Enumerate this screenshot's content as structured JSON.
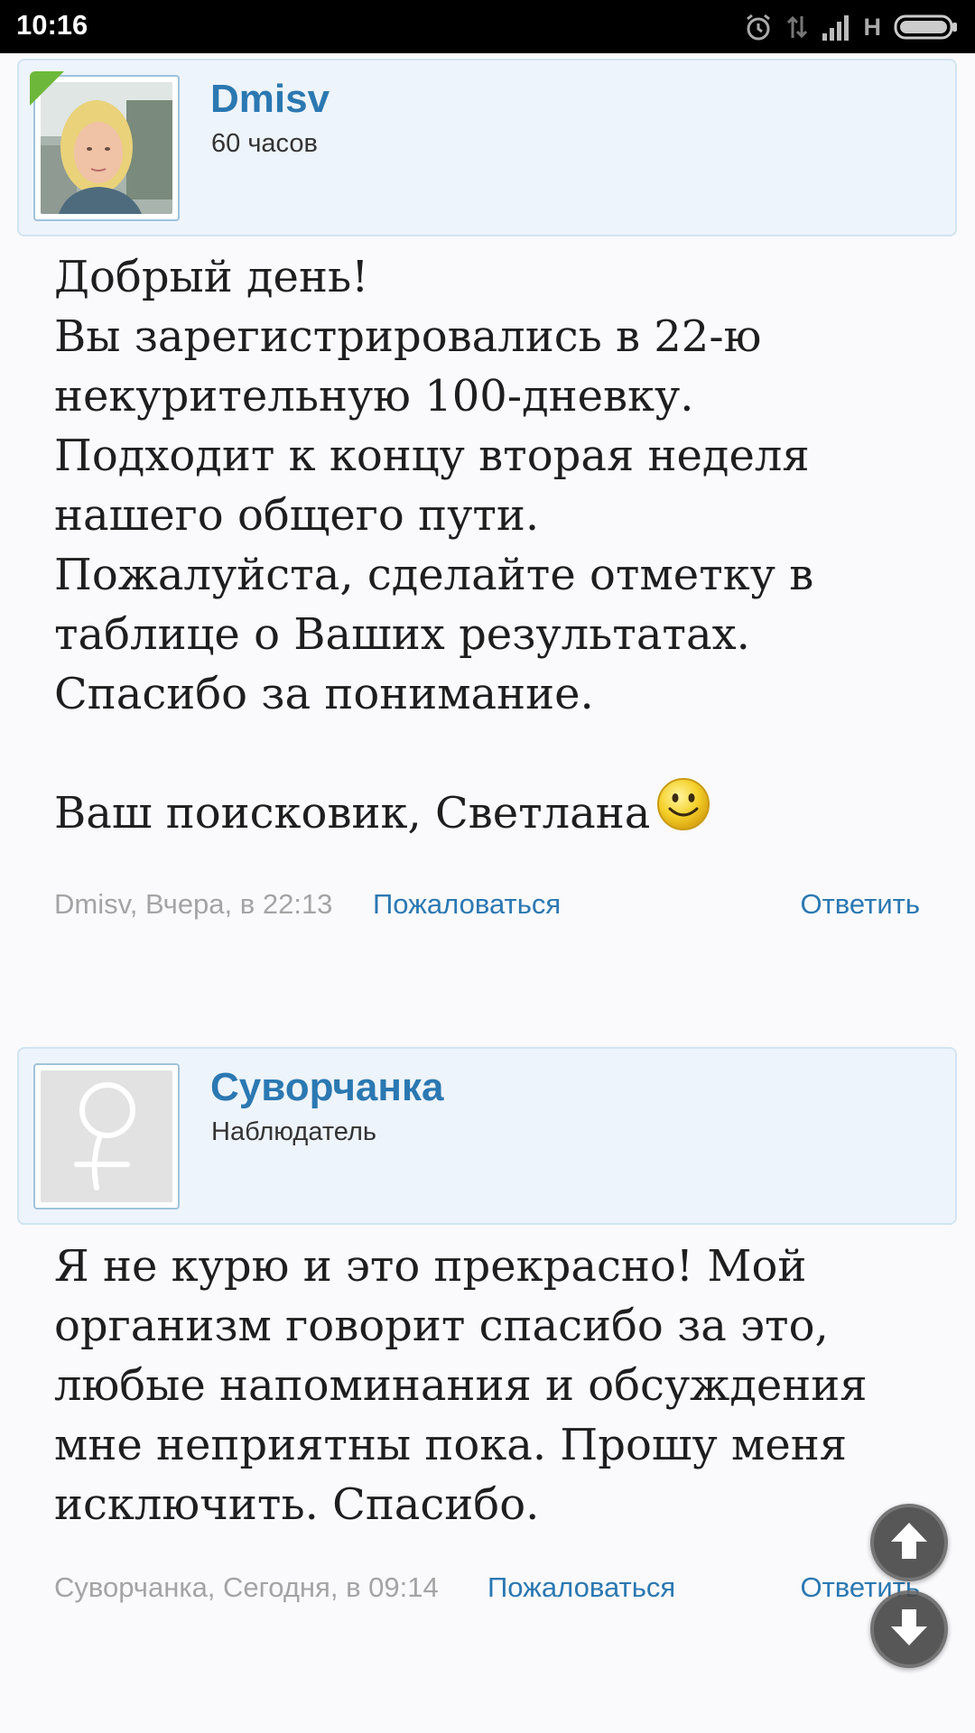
{
  "status_bar": {
    "time": "10:16",
    "network": "H",
    "icons": [
      "alarm-icon",
      "data-arrows-icon",
      "signal-icon",
      "battery-icon"
    ]
  },
  "posts": [
    {
      "author": "Dmisv",
      "user_status": "60 часов",
      "avatar": "user-photo",
      "online": true,
      "body": "Добрый день!\nВы зарегистрировались в 22-ю некурительную 100-дневку.\nПодходит к концу вторая неделя нашего общего пути.\nПожалуйста, сделайте отметку в таблице о Ваших результатах.\nСпасибо за понимание.\n\nВаш поисковик, Светлана",
      "emoticon": "smiley-icon",
      "meta": "Dmisv, Вчера, в 22:13",
      "report_label": "Пожаловаться",
      "reply_label": "Ответить"
    },
    {
      "author": "Суворчанка",
      "user_status": "Наблюдатель",
      "avatar": "female-symbol-placeholder",
      "online": false,
      "body": "Я не курю и это прекрасно! Мой организм говорит спасибо за это, любые напоминания и обсуждения мне неприятны пока. Прошу меня исключить. Спасибо.",
      "meta": "Суворчанка, Сегодня, в 09:14",
      "report_label": "Пожаловаться",
      "reply_label": "Ответить"
    }
  ],
  "scroll_buttons": {
    "up_icon": "arrow-up-icon",
    "down_icon": "arrow-down-icon"
  },
  "colors": {
    "link": "#2b78b2",
    "header_bg": "#eef4fb",
    "online": "#6db83a"
  }
}
